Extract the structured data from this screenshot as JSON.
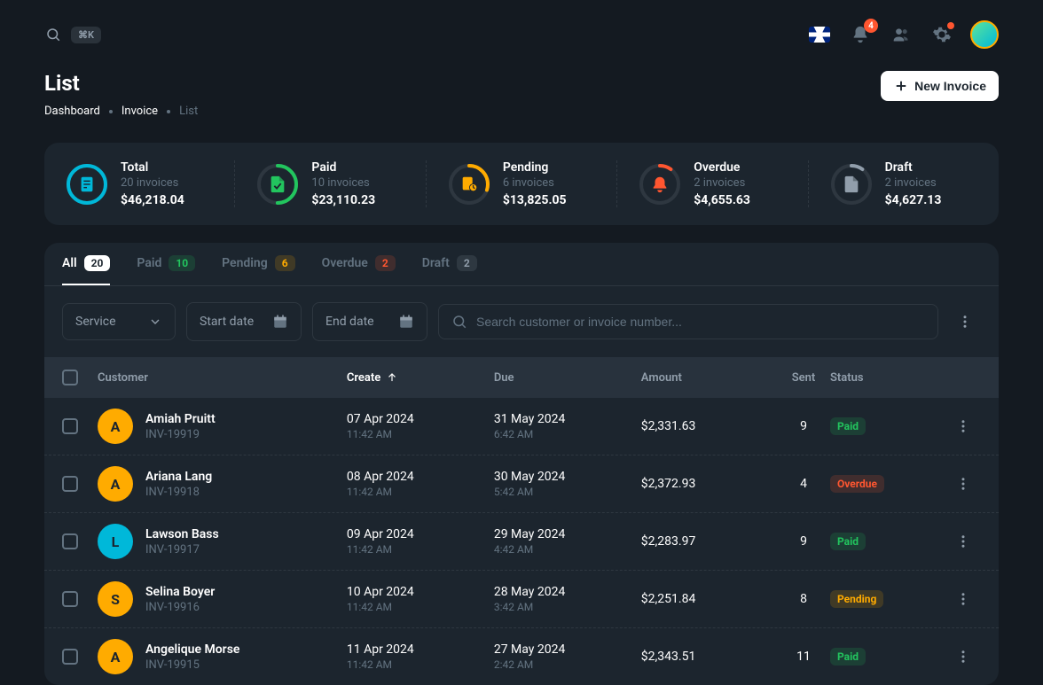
{
  "topbar": {
    "shortcut": "⌘K",
    "notif_count": "4"
  },
  "page": {
    "title": "List",
    "breadcrumb": [
      "Dashboard",
      "Invoice",
      "List"
    ],
    "new_button": "New Invoice"
  },
  "summary": [
    {
      "label": "Total",
      "count": "20 invoices",
      "amount": "$46,218.04",
      "color": "#00b8d9",
      "progress": 1.0,
      "icon": "file"
    },
    {
      "label": "Paid",
      "count": "10 invoices",
      "amount": "$23,110.23",
      "color": "#22c55e",
      "progress": 0.5,
      "icon": "check-file"
    },
    {
      "label": "Pending",
      "count": "6 invoices",
      "amount": "$13,825.05",
      "color": "#ffab00",
      "progress": 0.3,
      "icon": "clock"
    },
    {
      "label": "Overdue",
      "count": "2 invoices",
      "amount": "$4,655.63",
      "color": "#ff5630",
      "progress": 0.1,
      "icon": "bell"
    },
    {
      "label": "Draft",
      "count": "2 invoices",
      "amount": "$4,627.13",
      "color": "#919eab",
      "progress": 0.1,
      "icon": "draft"
    }
  ],
  "tabs": [
    {
      "label": "All",
      "count": "20",
      "cls": "tb-white",
      "active": true
    },
    {
      "label": "Paid",
      "count": "10",
      "cls": "tb-green"
    },
    {
      "label": "Pending",
      "count": "6",
      "cls": "tb-yellow"
    },
    {
      "label": "Overdue",
      "count": "2",
      "cls": "tb-red"
    },
    {
      "label": "Draft",
      "count": "2",
      "cls": "tb-gray"
    }
  ],
  "filters": {
    "service_placeholder": "Service",
    "start_placeholder": "Start date",
    "end_placeholder": "End date",
    "search_placeholder": "Search customer or invoice number..."
  },
  "columns": {
    "customer": "Customer",
    "create": "Create",
    "due": "Due",
    "amount": "Amount",
    "sent": "Sent",
    "status": "Status"
  },
  "rows": [
    {
      "initial": "A",
      "avatar_color": "#ffab00",
      "name": "Amiah Pruitt",
      "inv": "INV-19919",
      "create_date": "07 Apr 2024",
      "create_time": "11:42 AM",
      "due_date": "31 May 2024",
      "due_time": "6:42 AM",
      "amount": "$2,331.63",
      "sent": "9",
      "status": "Paid",
      "status_cls": "sp-paid"
    },
    {
      "initial": "A",
      "avatar_color": "#ffab00",
      "name": "Ariana Lang",
      "inv": "INV-19918",
      "create_date": "08 Apr 2024",
      "create_time": "11:42 AM",
      "due_date": "30 May 2024",
      "due_time": "5:42 AM",
      "amount": "$2,372.93",
      "sent": "4",
      "status": "Overdue",
      "status_cls": "sp-overdue"
    },
    {
      "initial": "L",
      "avatar_color": "#00b8d9",
      "name": "Lawson Bass",
      "inv": "INV-19917",
      "create_date": "09 Apr 2024",
      "create_time": "11:42 AM",
      "due_date": "29 May 2024",
      "due_time": "4:42 AM",
      "amount": "$2,283.97",
      "sent": "9",
      "status": "Paid",
      "status_cls": "sp-paid"
    },
    {
      "initial": "S",
      "avatar_color": "#ffab00",
      "name": "Selina Boyer",
      "inv": "INV-19916",
      "create_date": "10 Apr 2024",
      "create_time": "11:42 AM",
      "due_date": "28 May 2024",
      "due_time": "3:42 AM",
      "amount": "$2,251.84",
      "sent": "8",
      "status": "Pending",
      "status_cls": "sp-pending"
    },
    {
      "initial": "A",
      "avatar_color": "#ffab00",
      "name": "Angelique Morse",
      "inv": "INV-19915",
      "create_date": "11 Apr 2024",
      "create_time": "11:42 AM",
      "due_date": "27 May 2024",
      "due_time": "2:42 AM",
      "amount": "$2,343.51",
      "sent": "11",
      "status": "Paid",
      "status_cls": "sp-paid"
    }
  ]
}
